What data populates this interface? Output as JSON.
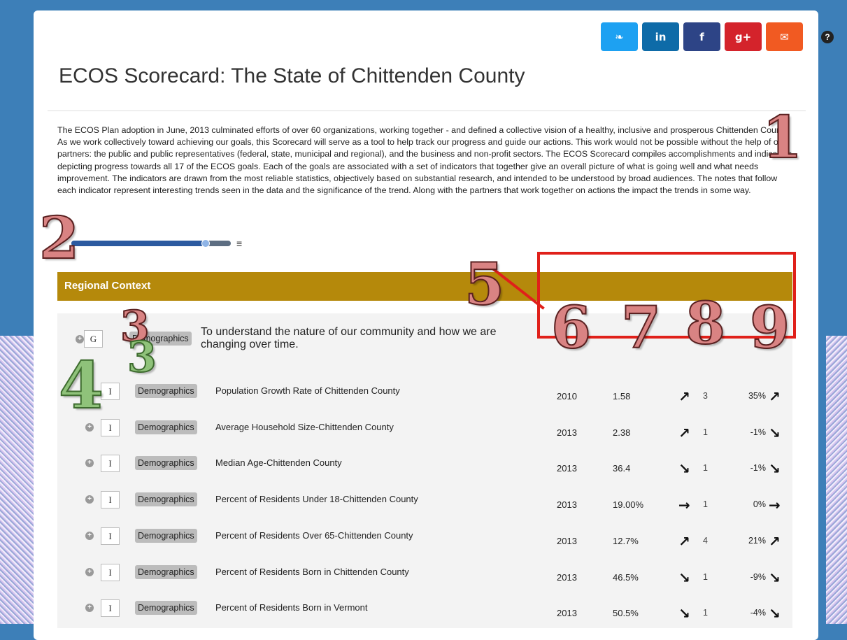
{
  "header": {
    "title": "ECOS Scorecard: The State of Chittenden County",
    "share": [
      {
        "name": "twitter-button",
        "icon": "twitter-icon",
        "glyph": "❧",
        "color": "#1da1f2"
      },
      {
        "name": "linkedin-button",
        "icon": "linkedin-icon",
        "glyph": "in",
        "color": "#0e6ba8"
      },
      {
        "name": "facebook-button",
        "icon": "facebook-icon",
        "glyph": "f",
        "color": "#2d4486"
      },
      {
        "name": "google-plus-button",
        "icon": "google-plus-icon",
        "glyph": "g+",
        "color": "#d4232b"
      },
      {
        "name": "email-button",
        "icon": "envelope-icon",
        "glyph": "✉",
        "color": "#f15a22"
      }
    ],
    "help_glyph": "?"
  },
  "intro": "The ECOS Plan adoption in June, 2013 culminated efforts of over 60 organizations, working together - and defined a collective vision of a healthy, inclusive and prosperous Chittenden County. As we work collectively toward achieving our goals, this Scorecard will serve as a tool to help track our progress and guide our actions. This work would not be possible without the help of our partners: the public and public representatives (federal, state, municipal and regional), and the business and non-profit sectors. The ECOS Scorecard compiles accomplishments and indicators depicting progress towards all 17 of the ECOS goals. Each of the goals are associated with a set of indicators that together give an overall picture of what is going well and what needs improvement. The indicators are drawn from the most reliable statistics, objectively based on substantial research, and intended to be understood by broad audiences. The notes that follow each indicator represent interesting trends seen in the data and the significance of the trend. Along with the partners that work together on actions the impact the trends in some way.",
  "slider": {
    "minus": "−",
    "menu": "≡",
    "level_percent": 84
  },
  "section": {
    "title": "Regional Context"
  },
  "group": {
    "type": "G",
    "tag": "Demographics",
    "description": "To understand the nature of our community and how we are changing over time."
  },
  "rows": [
    {
      "type": "I",
      "tag": "Demographics",
      "name": "Population Growth Rate of Chittenden County",
      "year": "2010",
      "value": "1.58",
      "trend": "↗",
      "trend_n": "3",
      "pct": "35%",
      "pct_arrow": "↗"
    },
    {
      "type": "I",
      "tag": "Demographics",
      "name": "Average Household Size-Chittenden County",
      "year": "2013",
      "value": "2.38",
      "trend": "↗",
      "trend_n": "1",
      "pct": "-1%",
      "pct_arrow": "↘"
    },
    {
      "type": "I",
      "tag": "Demographics",
      "name": "Median Age-Chittenden County",
      "year": "2013",
      "value": "36.4",
      "trend": "↘",
      "trend_n": "1",
      "pct": "-1%",
      "pct_arrow": "↘"
    },
    {
      "type": "I",
      "tag": "Demographics",
      "name": "Percent of Residents Under 18-Chittenden County",
      "year": "2013",
      "value": "19.00%",
      "trend": "→",
      "trend_n": "1",
      "pct": "0%",
      "pct_arrow": "→"
    },
    {
      "type": "I",
      "tag": "Demographics",
      "name": "Percent of Residents Over 65-Chittenden County",
      "year": "2013",
      "value": "12.7%",
      "trend": "↗",
      "trend_n": "4",
      "pct": "21%",
      "pct_arrow": "↗"
    },
    {
      "type": "I",
      "tag": "Demographics",
      "name": "Percent of Residents Born in Chittenden County",
      "year": "2013",
      "value": "46.5%",
      "trend": "↘",
      "trend_n": "1",
      "pct": "-9%",
      "pct_arrow": "↘"
    },
    {
      "type": "I",
      "tag": "Demographics",
      "name": "Percent of Residents Born in Vermont",
      "year": "2013",
      "value": "50.5%",
      "trend": "↘",
      "trend_n": "1",
      "pct": "-4%",
      "pct_arrow": "↘"
    }
  ],
  "callouts": [
    "1",
    "2",
    "3",
    "3",
    "4",
    "5",
    "6",
    "7",
    "8",
    "9"
  ]
}
